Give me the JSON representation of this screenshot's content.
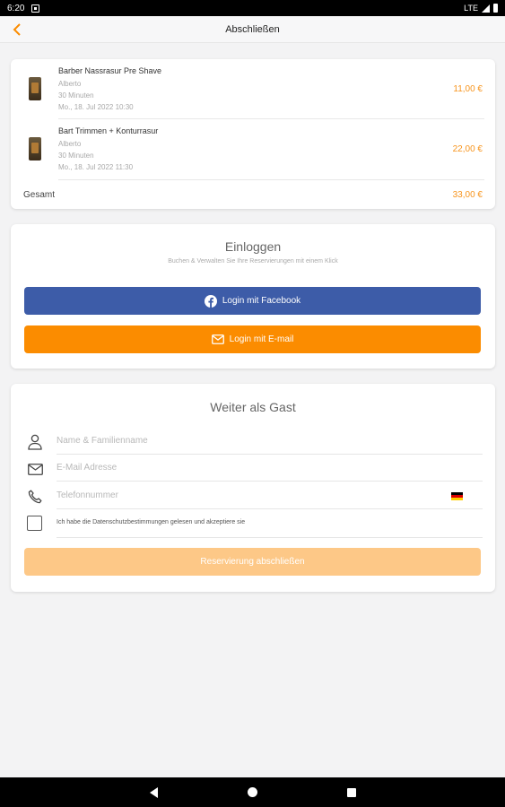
{
  "status_bar": {
    "time": "6:20",
    "network": "LTE"
  },
  "app_bar": {
    "title": "Abschließen"
  },
  "order": {
    "items": [
      {
        "name": "Barber Nassrasur Pre Shave",
        "staff": "Alberto",
        "duration": "30 Minuten",
        "datetime": "Mo., 18. Jul 2022 10:30",
        "price": "11,00 €"
      },
      {
        "name": "Bart Trimmen + Konturrasur",
        "staff": "Alberto",
        "duration": "30 Minuten",
        "datetime": "Mo., 18. Jul 2022 11:30",
        "price": "22,00 €"
      }
    ],
    "total_label": "Gesamt",
    "total_price": "33,00 €"
  },
  "login": {
    "heading": "Einloggen",
    "subtitle": "Buchen & Verwalten Sie Ihre Reservierungen mit einem Klick",
    "facebook_label": "Login mit Facebook",
    "email_label": "Login mit E-mail"
  },
  "guest": {
    "heading": "Weiter als Gast",
    "name_placeholder": "Name & Familienname",
    "email_placeholder": "E-Mail Adresse",
    "phone_placeholder": "Telefonnummer",
    "consent_text": "Ich habe die Datenschutzbestimmungen gelesen und akzeptiere sie",
    "submit_label": "Reservierung abschließen"
  },
  "colors": {
    "accent": "#fb8c00",
    "accent_disabled": "#fdc887",
    "facebook": "#3d5ca8",
    "price": "#f7941d"
  },
  "icons": [
    "chevron-left-icon",
    "facebook-icon",
    "mail-icon",
    "person-icon",
    "envelope-icon",
    "phone-icon",
    "german-flag-icon"
  ]
}
